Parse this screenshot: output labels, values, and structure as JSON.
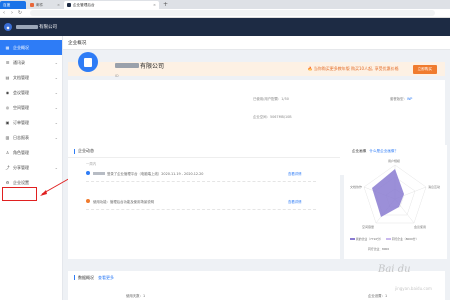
{
  "browser": {
    "tabs": [
      {
        "label": "百度",
        "active": false
      },
      {
        "label": "邮件",
        "active": false
      },
      {
        "label": "企业管理后台",
        "active": true
      }
    ],
    "new_tab": "+",
    "close": "×"
  },
  "app": {
    "company_suffix": "有限公司"
  },
  "sidebar": {
    "items": [
      {
        "label": "企业概况",
        "icon": "grid-icon",
        "glyph": "▦"
      },
      {
        "label": "通讯录",
        "icon": "contacts-icon",
        "glyph": "☰"
      },
      {
        "label": "文档管理",
        "icon": "document-icon",
        "glyph": "▤"
      },
      {
        "label": "会议管理",
        "icon": "meeting-icon",
        "glyph": "◉"
      },
      {
        "label": "空间管理",
        "icon": "space-icon",
        "glyph": "◎"
      },
      {
        "label": "订单管理",
        "icon": "order-icon",
        "glyph": "▣"
      },
      {
        "label": "日志报表",
        "icon": "report-icon",
        "glyph": "▥"
      },
      {
        "label": "角色管理",
        "icon": "role-icon",
        "glyph": "♙"
      },
      {
        "label": "分享管理",
        "icon": "share-icon",
        "glyph": "⤴"
      },
      {
        "label": "企业设置",
        "icon": "gear-icon",
        "glyph": "⚙"
      }
    ]
  },
  "main": {
    "title": "企业概况",
    "banner": {
      "text": "🔥 当你购买更多教年版 购买10人起, 享受优惠价格",
      "button": "立即购买"
    },
    "enterprise": {
      "name_suffix": "有限公司",
      "sub": "ID",
      "stat_members": "已使用/用户配置：1/50",
      "stat_space": "企业空间：5067MB/10B",
      "stat_version_label": "套餐版型：",
      "stat_version_value": "WP"
    },
    "news": {
      "title": "企业动态",
      "sub": "一周内",
      "items": [
        {
          "text": "登录了企业管理平台（电脑端上线）2020.11.19 - 2020.12.20",
          "link": "查看详情"
        },
        {
          "text": "使用功能：管理后台功能及使用场景说明",
          "link": "查看详情"
        }
      ]
    },
    "radar": {
      "title": "企业画像",
      "link": "什么是企业画像？",
      "axes": [
        "用户规模",
        "文档协作",
        "空间容量",
        "会议使用",
        "消息互动"
      ],
      "legend": [
        "我的企业（7710分）",
        "同行企业（8000分）"
      ],
      "legend2": "同行企业：8000",
      "colors": {
        "mine": "#8a7bd1",
        "peer": "#c9b8ee"
      }
    },
    "data": {
      "title": "数据概况",
      "more": "查看更多",
      "left": "使用天数：1",
      "right": "企业设置：1"
    }
  },
  "watermark": {
    "brand": "Bai du",
    "site": "jingyan.baidu.com"
  }
}
